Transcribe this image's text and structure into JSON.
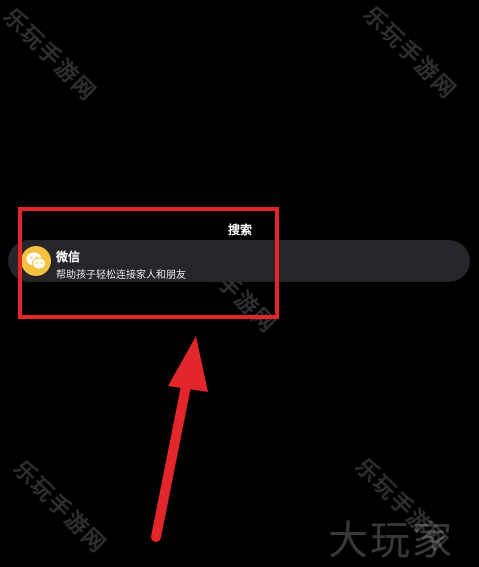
{
  "watermarks": {
    "text": "乐玩手游网",
    "brand": "大玩家"
  },
  "search_header": {
    "label": "搜索"
  },
  "result": {
    "app_name": "微信",
    "description": "帮助孩子轻松连接家人和朋友",
    "icon": "wechat-icon"
  },
  "colors": {
    "background": "#000000",
    "pill": "#26262a",
    "highlight": "#e3262b",
    "icon_bg": "#f4c23c"
  }
}
